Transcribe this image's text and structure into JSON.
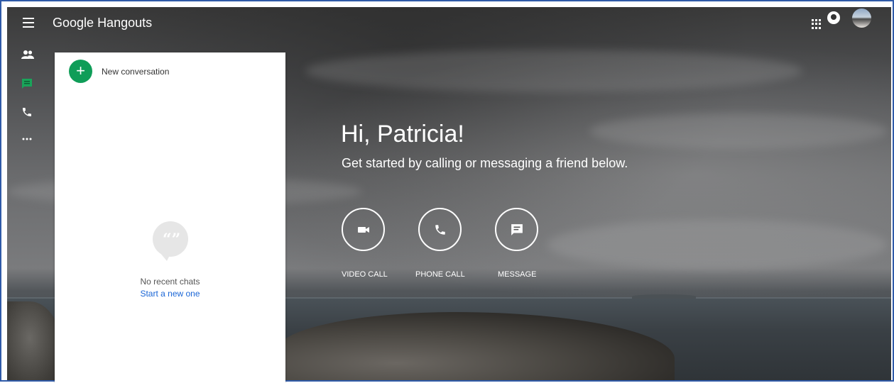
{
  "header": {
    "app_title_brand": "Google",
    "app_title_product": "Hangouts"
  },
  "icons": {
    "menu": "hamburger-menu-icon",
    "apps": "apps-grid-icon",
    "status": "status-icon",
    "avatar": "profile-avatar"
  },
  "rail": {
    "items": [
      {
        "name": "contacts",
        "icon": "people-icon"
      },
      {
        "name": "conversations",
        "icon": "chat-icon",
        "active": true
      },
      {
        "name": "phone-calls",
        "icon": "phone-icon"
      },
      {
        "name": "more",
        "icon": "more-horizontal-icon"
      }
    ]
  },
  "panel": {
    "new_conversation_label": "New conversation",
    "empty_text": "No recent chats",
    "empty_link": "Start a new one"
  },
  "main": {
    "greeting": "Hi, Patricia!",
    "subtitle": "Get started by calling or messaging a friend below.",
    "actions": [
      {
        "label": "VIDEO CALL",
        "icon": "videocam-icon"
      },
      {
        "label": "PHONE CALL",
        "icon": "phone-icon"
      },
      {
        "label": "MESSAGE",
        "icon": "message-icon"
      }
    ]
  },
  "colors": {
    "accent_green": "#0f9d58",
    "link_blue": "#1a66d6"
  }
}
